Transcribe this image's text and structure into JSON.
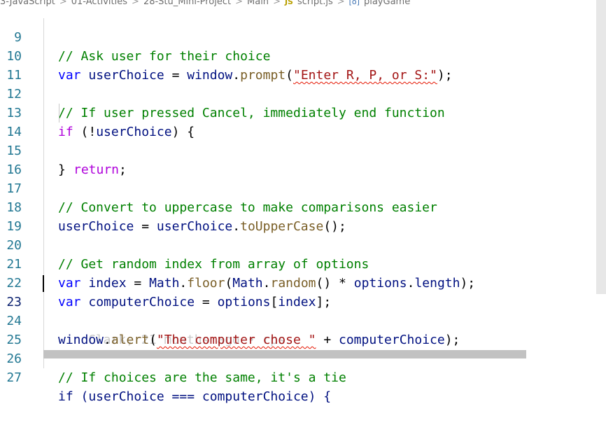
{
  "breadcrumb": {
    "items": [
      "3-JavaScript",
      "01-Activities",
      "28-Stu_Mini-Project",
      "Main",
      "script.js",
      "playGame"
    ],
    "separator": ">",
    "file_icon": "JS",
    "symbol_icon": "[o]"
  },
  "editor": {
    "active_line": 23,
    "lines": [
      {
        "n": "9"
      },
      {
        "n": "10"
      },
      {
        "n": "11"
      },
      {
        "n": "12"
      },
      {
        "n": "13"
      },
      {
        "n": "14"
      },
      {
        "n": "15"
      },
      {
        "n": "16"
      },
      {
        "n": "17"
      },
      {
        "n": "18"
      },
      {
        "n": "19"
      },
      {
        "n": "20"
      },
      {
        "n": "21"
      },
      {
        "n": "22"
      },
      {
        "n": "23"
      },
      {
        "n": "24"
      },
      {
        "n": "25"
      },
      {
        "n": "26"
      },
      {
        "n": "27"
      }
    ],
    "code": {
      "l9_cmt": "// Ask user for their choice",
      "l10_var": "var",
      "l10_name": "userChoice",
      "l10_eq": " = ",
      "l10_obj": "window",
      "l10_dot": ".",
      "l10_fn": "prompt",
      "l10_open": "(",
      "l10_str": "\"Enter R, P, or S:\"",
      "l10_close": ");",
      "l12_cmt": "// If user pressed Cancel, immediately end function",
      "l13_if": "if",
      "l13_rest1": " (!",
      "l13_name": "userChoice",
      "l13_rest2": ") {",
      "l14_ret": "return",
      "l14_semi": ";",
      "l15_close": "}",
      "l17_cmt": "// Convert to uppercase to make comparisons easier",
      "l18_name": "userChoice",
      "l18_eq": " = ",
      "l18_name2": "userChoice",
      "l18_dot": ".",
      "l18_fn": "toUpperCase",
      "l18_end": "();",
      "l20_cmt": "// Get random index from array of options",
      "l21_var": "var",
      "l21_name": "index",
      "l21_eq": " = ",
      "l21_math": "Math",
      "l21_dot": ".",
      "l21_fn": "floor",
      "l21_p": "(",
      "l21_math2": "Math",
      "l21_dot2": ".",
      "l21_fn2": "random",
      "l21_mid": "() ",
      "l21_mul": "*",
      "l21_sp": " ",
      "l21_opt": "options",
      "l21_dot3": ".",
      "l21_len": "length",
      "l21_end": ");",
      "l22_var": "var",
      "l22_name": "computerChoice",
      "l22_eq": " = ",
      "l22_opt": "options",
      "l22_open": "[",
      "l22_idx": "index",
      "l22_close": "];",
      "l23_blame": "Clark, 21 months ago • rps",
      "l24_obj": "window",
      "l24_dot": ".",
      "l24_fn": "alert",
      "l24_open": "(",
      "l24_str": "\"The computer chose \"",
      "l24_plus": " + ",
      "l24_name": "computerChoice",
      "l24_end": ");",
      "l26_cmt": "// If choices are the same, it's a tie",
      "l27_partial": "if (userChoice === computerChoice) {"
    }
  },
  "colors": {
    "keyword": "#0000ff",
    "control": "#af00db",
    "variable": "#001080",
    "function": "#795e26",
    "string": "#a31515",
    "comment": "#008000",
    "line_number": "#237893"
  }
}
